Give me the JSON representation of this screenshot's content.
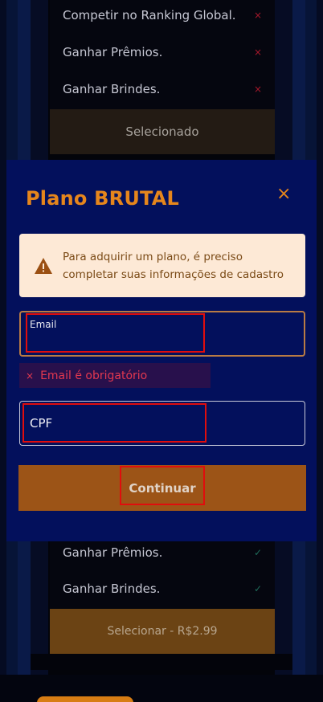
{
  "background": {
    "top_items": [
      {
        "label": "Competir no Ranking Global.",
        "mark": "×"
      },
      {
        "label": "Ganhar Prêmios.",
        "mark": "×"
      },
      {
        "label": "Ganhar Brindes.",
        "mark": "×"
      }
    ],
    "selected_label": "Selecionado",
    "bottom_items": [
      {
        "label": "Ganhar Prêmios.",
        "mark": "✓"
      },
      {
        "label": "Ganhar Brindes.",
        "mark": "✓"
      }
    ],
    "select_price_label": "Selecionar - R$2.99"
  },
  "modal": {
    "title": "Plano BRUTAL",
    "close_icon": "×",
    "alert": {
      "icon": "warning-icon",
      "text": "Para adquirir um plano, é preciso completar suas informações de cadastro"
    },
    "email": {
      "label": "Email",
      "value": "",
      "error_icon": "×",
      "error": "Email é obrigatório"
    },
    "cpf": {
      "label": "CPF",
      "value": ""
    },
    "continue_label": "Continuar"
  },
  "colors": {
    "accent": "#e6861c",
    "modal_bg": "#03105c",
    "error": "#e2384f",
    "annotation": "#e00d0d"
  }
}
